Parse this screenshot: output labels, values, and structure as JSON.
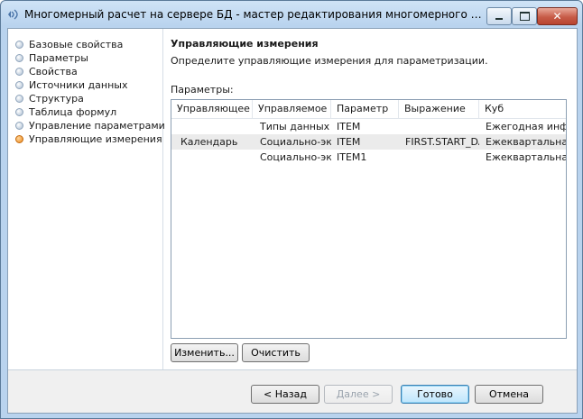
{
  "window": {
    "title": "Многомерный расчет на сервере БД - мастер редактирования многомерного расчета на...",
    "close_label": "✕"
  },
  "nav": {
    "items": [
      {
        "label": "Базовые свойства",
        "active": false
      },
      {
        "label": "Параметры",
        "active": false
      },
      {
        "label": "Свойства",
        "active": false
      },
      {
        "label": "Источники данных",
        "active": false
      },
      {
        "label": "Структура",
        "active": false
      },
      {
        "label": "Таблица формул",
        "active": false
      },
      {
        "label": "Управление параметрами",
        "active": false
      },
      {
        "label": "Управляющие измерения",
        "active": true
      }
    ]
  },
  "page": {
    "heading": "Управляющие измерения",
    "description": "Определите управляющие измерения для параметризации.",
    "params_label": "Параметры:"
  },
  "grid": {
    "columns": [
      "Управляющее",
      "Управляемое",
      "Параметр",
      "Выражение",
      "Куб"
    ],
    "rows": [
      [
        "",
        "Типы данных -",
        "ITEM",
        "",
        "Ежегодная инф"
      ],
      [
        "Календарь",
        "Социально-эк.",
        "ITEM",
        "FIRST.START_DAT",
        "Ежеквартальная"
      ],
      [
        "",
        "Социально-эк.",
        "ITEM1",
        "",
        "Ежеквартальная"
      ]
    ],
    "selected_row": 1
  },
  "actions": {
    "edit": "Изменить...",
    "clear": "Очистить"
  },
  "footer": {
    "back": "< Назад",
    "next": "Далее >",
    "finish": "Готово",
    "cancel": "Отмена"
  },
  "icons": {
    "app": "app-icon",
    "minimize": "minimize-icon",
    "maximize": "maximize-icon",
    "close": "close-icon",
    "bullet": "step-bullet-icon",
    "active_bullet": "active-step-bullet-icon"
  },
  "colors": {
    "active_bullet": "#ec8a1c",
    "selected_row": "#ebebeb",
    "close_button": "#c75c48"
  }
}
